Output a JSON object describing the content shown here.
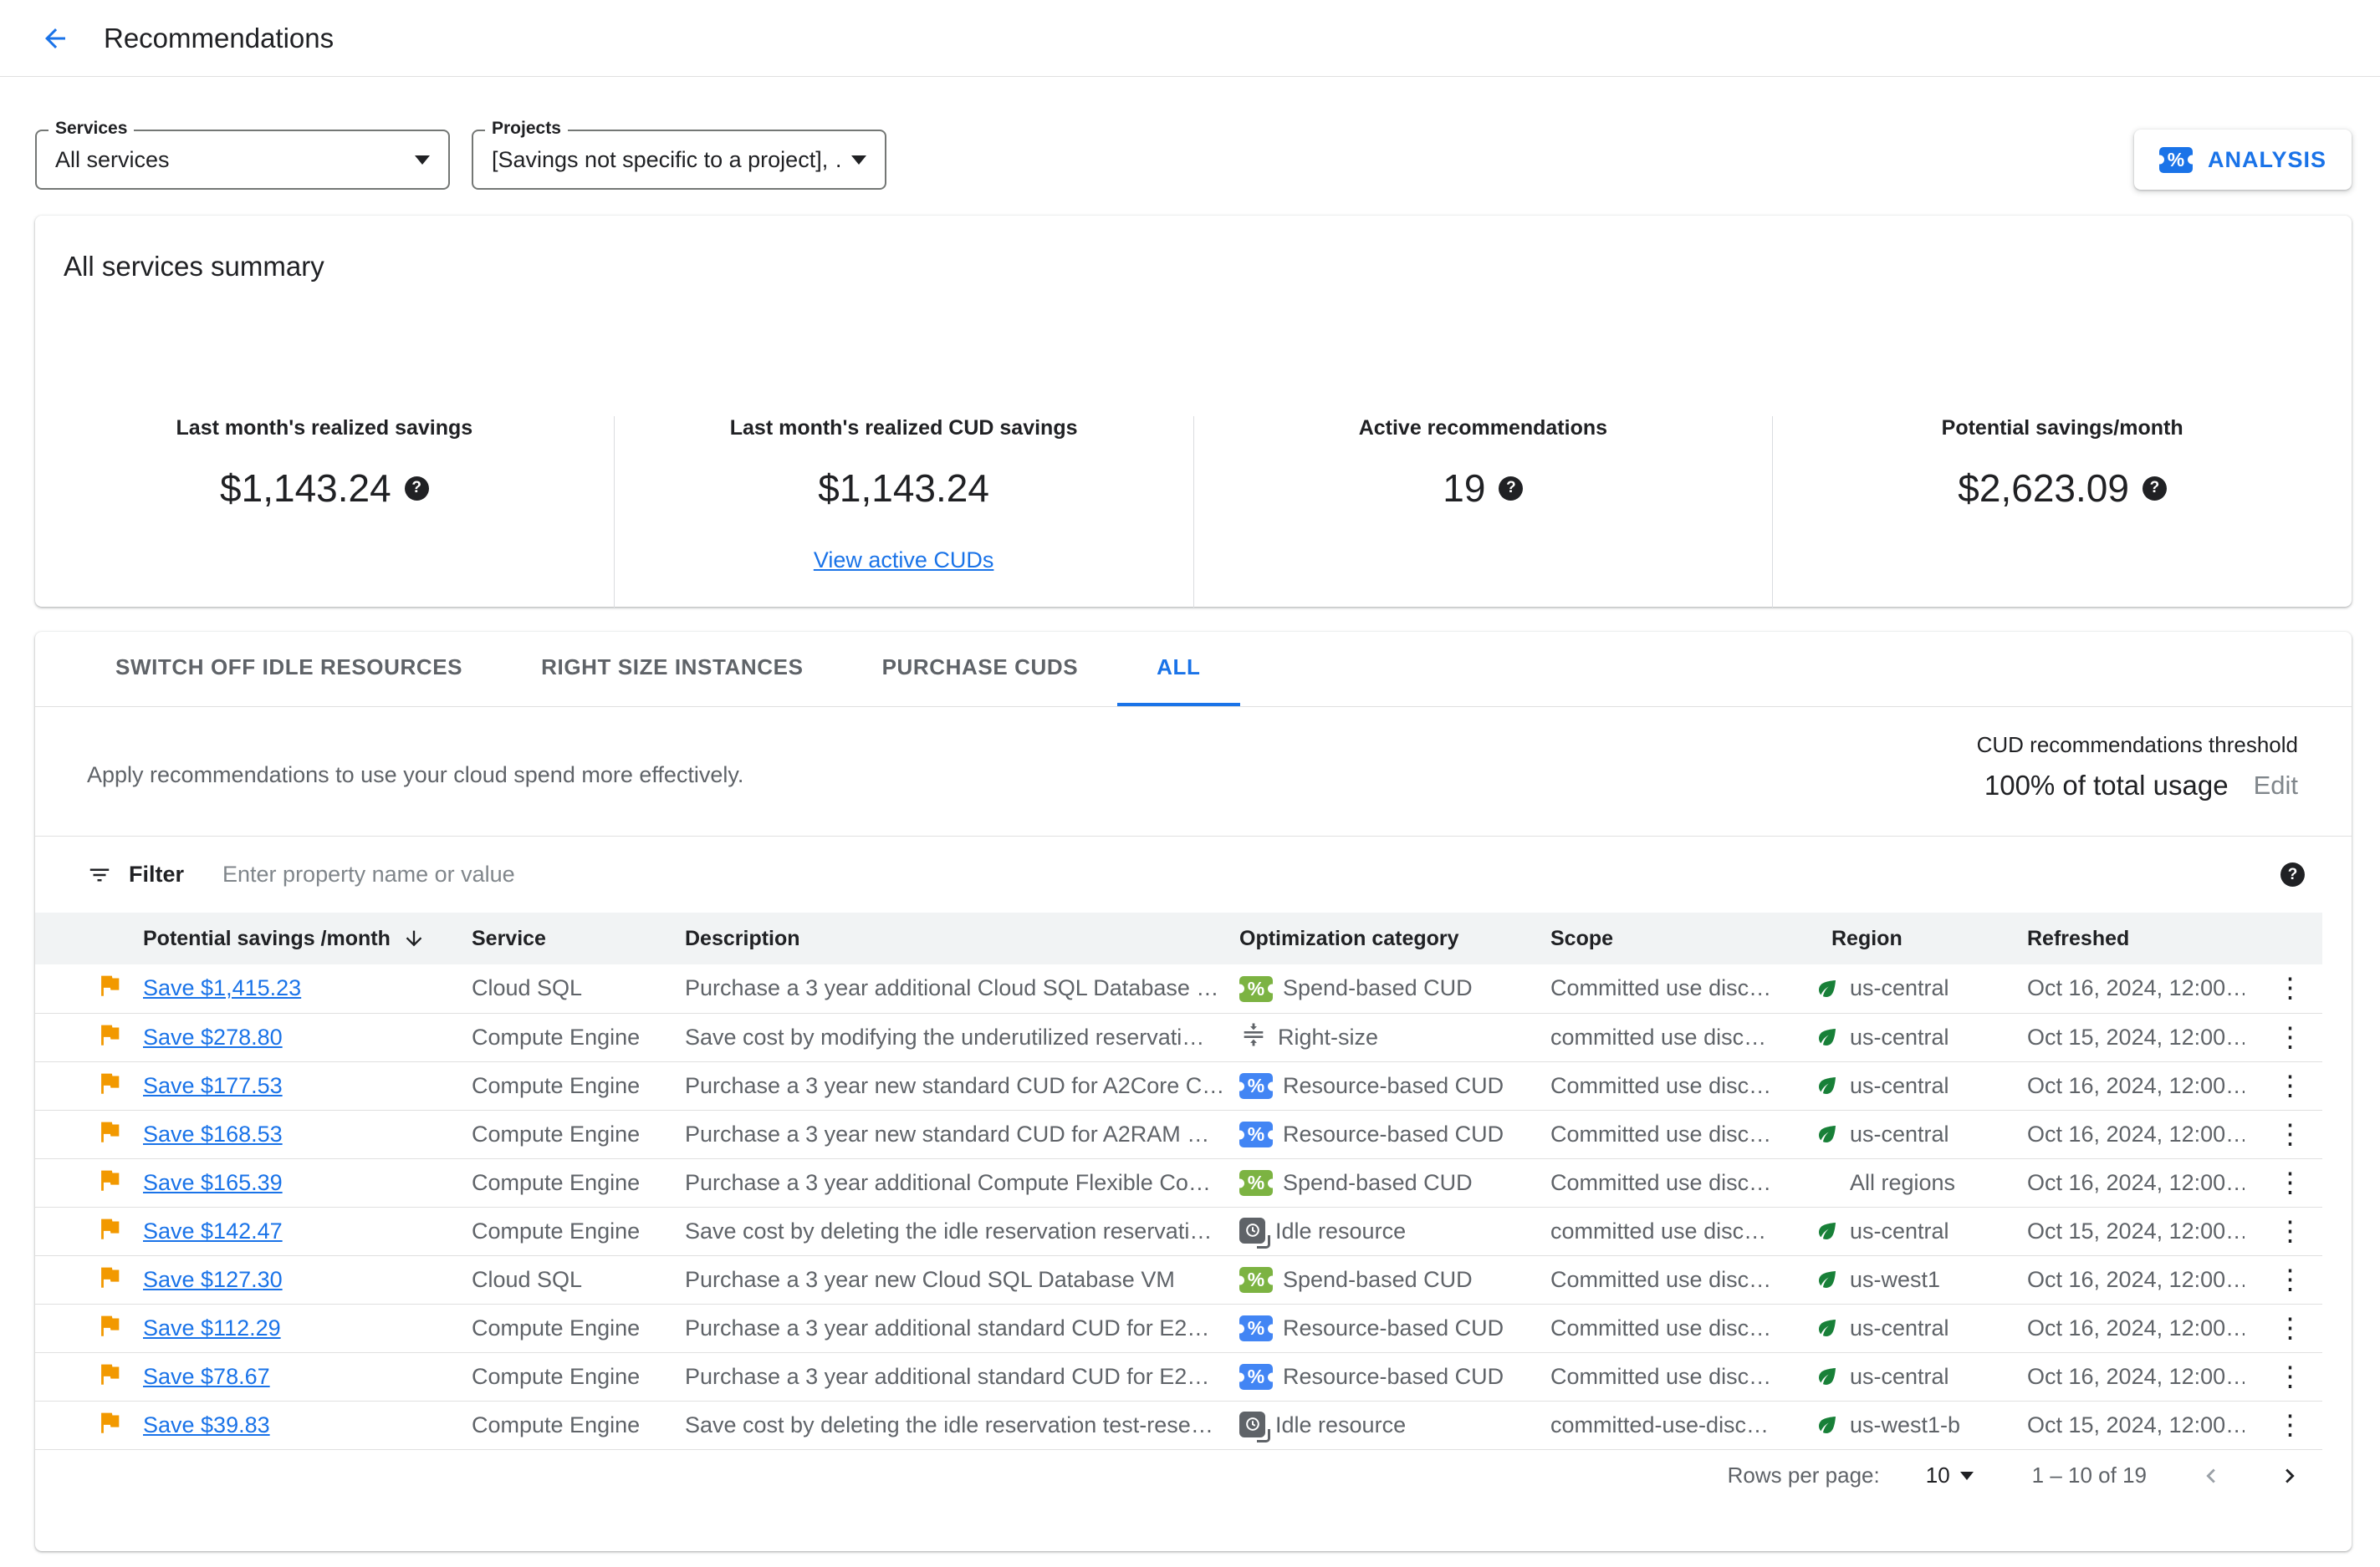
{
  "header": {
    "title": "Recommendations"
  },
  "controls": {
    "services": {
      "label": "Services",
      "value": "All services"
    },
    "projects": {
      "label": "Projects",
      "value": "[Savings not specific to a project], …"
    },
    "analysis_button": "ANALYSIS"
  },
  "summary": {
    "title": "All services summary",
    "stats": [
      {
        "label": "Last month's realized savings",
        "value": "$1,143.24"
      },
      {
        "label": "Last month's realized CUD savings",
        "value": "$1,143.24",
        "link": "View active CUDs"
      },
      {
        "label": "Active recommendations",
        "value": "19"
      },
      {
        "label": "Potential savings/month",
        "value": "$2,623.09"
      }
    ]
  },
  "tabs": [
    {
      "label": "SWITCH OFF IDLE RESOURCES",
      "active": false
    },
    {
      "label": "RIGHT SIZE INSTANCES",
      "active": false
    },
    {
      "label": "PURCHASE CUDS",
      "active": false
    },
    {
      "label": "ALL",
      "active": true
    }
  ],
  "panel": {
    "description": "Apply recommendations to use your cloud spend more effectively.",
    "threshold_label": "CUD recommendations threshold",
    "threshold_value": "100% of total usage",
    "threshold_edit": "Edit"
  },
  "filter_bar": {
    "label": "Filter",
    "placeholder": "Enter property name or value"
  },
  "table": {
    "columns": [
      "Potential savings /month",
      "Service",
      "Description",
      "Optimization category",
      "Scope",
      "Region",
      "Refreshed"
    ],
    "rows": [
      {
        "savings": "Save $1,415.23",
        "service": "Cloud SQL",
        "description": "Purchase a 3 year additional Cloud SQL Database …",
        "category": "Spend-based CUD",
        "category_type": "spend",
        "scope": "Committed use disc…",
        "region": "us-central",
        "region_leaf": true,
        "refreshed": "Oct 16, 2024, 12:00…"
      },
      {
        "savings": "Save $278.80",
        "service": "Compute Engine",
        "description": "Save cost by modifying the underutilized reservati…",
        "category": "Right-size",
        "category_type": "rightsize",
        "scope": "committed use disc…",
        "region": "us-central",
        "region_leaf": true,
        "refreshed": "Oct 15, 2024, 12:00…"
      },
      {
        "savings": "Save $177.53",
        "service": "Compute Engine",
        "description": "Purchase a 3 year new standard CUD for A2Core C…",
        "category": "Resource-based CUD",
        "category_type": "resource",
        "scope": "Committed use disc…",
        "region": "us-central",
        "region_leaf": true,
        "refreshed": "Oct 16, 2024, 12:00…"
      },
      {
        "savings": "Save $168.53",
        "service": "Compute Engine",
        "description": "Purchase a 3 year new standard CUD for A2RAM …",
        "category": "Resource-based CUD",
        "category_type": "resource",
        "scope": "Committed use disc…",
        "region": "us-central",
        "region_leaf": true,
        "refreshed": "Oct 16, 2024, 12:00…"
      },
      {
        "savings": "Save $165.39",
        "service": "Compute Engine",
        "description": "Purchase a 3 year additional Compute Flexible Co…",
        "category": "Spend-based CUD",
        "category_type": "spend",
        "scope": "Committed use disc…",
        "region": "All regions",
        "region_leaf": false,
        "refreshed": "Oct 16, 2024, 12:00…"
      },
      {
        "savings": "Save $142.47",
        "service": "Compute Engine",
        "description": "Save cost by deleting the idle reservation reservati…",
        "category": "Idle resource",
        "category_type": "idle",
        "scope": "committed use disc…",
        "region": "us-central",
        "region_leaf": true,
        "refreshed": "Oct 15, 2024, 12:00…"
      },
      {
        "savings": "Save $127.30",
        "service": "Cloud SQL",
        "description": "Purchase a 3 year new Cloud SQL Database VM",
        "category": "Spend-based CUD",
        "category_type": "spend",
        "scope": "Committed use disc…",
        "region": "us-west1",
        "region_leaf": true,
        "refreshed": "Oct 16, 2024, 12:00…"
      },
      {
        "savings": "Save $112.29",
        "service": "Compute Engine",
        "description": "Purchase a 3 year additional standard CUD for E2…",
        "category": "Resource-based CUD",
        "category_type": "resource",
        "scope": "Committed use disc…",
        "region": "us-central",
        "region_leaf": true,
        "refreshed": "Oct 16, 2024, 12:00…"
      },
      {
        "savings": "Save $78.67",
        "service": "Compute Engine",
        "description": "Purchase a 3 year additional standard CUD for E2…",
        "category": "Resource-based CUD",
        "category_type": "resource",
        "scope": "Committed use disc…",
        "region": "us-central",
        "region_leaf": true,
        "refreshed": "Oct 16, 2024, 12:00…"
      },
      {
        "savings": "Save $39.83",
        "service": "Compute Engine",
        "description": "Save cost by deleting the idle reservation test-rese…",
        "category": "Idle resource",
        "category_type": "idle",
        "scope": "committed-use-disc…",
        "region": "us-west1-b",
        "region_leaf": true,
        "refreshed": "Oct 15, 2024, 12:00…"
      }
    ]
  },
  "pagination": {
    "rows_per_page_label": "Rows per page:",
    "rows_per_page": "10",
    "range": "1 – 10 of 19"
  },
  "colors": {
    "accent": "#1a73e8",
    "spend": "#7cb342",
    "resource": "#4285f4",
    "idle": "#5f6368",
    "leaf": "#188038",
    "flag": "#f29900"
  }
}
